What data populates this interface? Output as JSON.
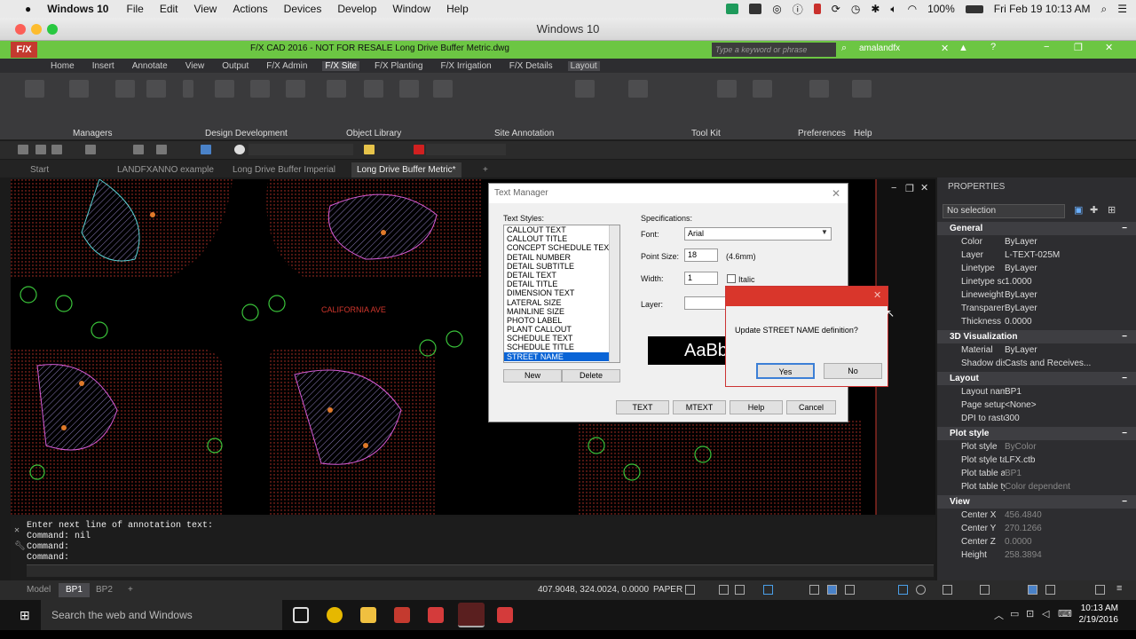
{
  "mac_menubar": {
    "app": "Windows 10",
    "menus": [
      "File",
      "Edit",
      "View",
      "Actions",
      "Devices",
      "Develop",
      "Window",
      "Help"
    ],
    "battery": "100%",
    "datetime": "Fri Feb 19  10:13 AM"
  },
  "window_title": "Windows 10",
  "acad": {
    "logo": "F/X",
    "title": "F/X CAD 2016 - NOT FOR RESALE    Long Drive Buffer Metric.dwg",
    "search_placeholder": "Type a keyword or phrase",
    "user": "amalandfx",
    "ribbon_tabs": [
      "Home",
      "Insert",
      "Annotate",
      "View",
      "Output",
      "F/X Admin",
      "F/X Site",
      "F/X Planting",
      "F/X Irrigation",
      "F/X Details",
      "Layout"
    ],
    "active_tab": "F/X Site",
    "ribbon_groups": [
      "Managers",
      "Design Development",
      "Object Library",
      "Site Annotation",
      "Tool Kit",
      "Preferences",
      "Help"
    ],
    "file_tabs": [
      "Start",
      "LANDFXANNO example",
      "Long Drive Buffer Imperial",
      "Long Drive Buffer Metric*"
    ],
    "active_file": "Long Drive Buffer Metric*"
  },
  "drawing": {
    "street_label": "CALIFORNIA  AVE"
  },
  "text_manager": {
    "title": "Text Manager",
    "styles_label": "Text Styles:",
    "styles": [
      "CALLOUT TEXT",
      "CALLOUT TITLE",
      "CONCEPT SCHEDULE TEXT",
      "DETAIL NUMBER",
      "DETAIL SUBTITLE",
      "DETAIL TEXT",
      "DETAIL TITLE",
      "DIMENSION TEXT",
      "LATERAL SIZE",
      "MAINLINE SIZE",
      "PHOTO LABEL",
      "PLANT CALLOUT",
      "SCHEDULE TEXT",
      "SCHEDULE TITLE",
      "STREET NAME"
    ],
    "selected_style": "STREET NAME",
    "new_btn": "New",
    "delete_btn": "Delete",
    "specs_label": "Specifications:",
    "font_label": "Font:",
    "font_value": "Arial",
    "point_size_label": "Point Size:",
    "point_size_value": "18",
    "point_size_mm": "(4.6mm)",
    "width_label": "Width:",
    "width_value": "1",
    "italic_label": "Italic",
    "layer_label": "Layer:",
    "preview": "AaBb",
    "text_btn": "TEXT",
    "mtext_btn": "MTEXT",
    "help_btn": "Help",
    "cancel_btn": "Cancel"
  },
  "prompt": {
    "message": "Update STREET NAME definition?",
    "yes": "Yes",
    "no": "No"
  },
  "properties": {
    "header": "PROPERTIES",
    "selection": "No selection",
    "sections": [
      {
        "name": "General",
        "rows": [
          {
            "k": "Color",
            "v": "ByLayer"
          },
          {
            "k": "Layer",
            "v": "L-TEXT-025M"
          },
          {
            "k": "Linetype",
            "v": "ByLayer"
          },
          {
            "k": "Linetype scale",
            "v": "1.0000"
          },
          {
            "k": "Lineweight",
            "v": "ByLayer"
          },
          {
            "k": "Transparency",
            "v": "ByLayer"
          },
          {
            "k": "Thickness",
            "v": "0.0000"
          }
        ]
      },
      {
        "name": "3D Visualization",
        "rows": [
          {
            "k": "Material",
            "v": "ByLayer"
          },
          {
            "k": "Shadow display",
            "v": "Casts and Receives..."
          }
        ]
      },
      {
        "name": "Layout",
        "rows": [
          {
            "k": "Layout name",
            "v": "BP1"
          },
          {
            "k": "Page setup na...",
            "v": "<None>"
          },
          {
            "k": "DPI to raster",
            "v": "300"
          }
        ]
      },
      {
        "name": "Plot style",
        "rows": [
          {
            "k": "Plot style",
            "v": "ByColor"
          },
          {
            "k": "Plot style table",
            "v": "LFX.ctb"
          },
          {
            "k": "Plot table attac...",
            "v": "BP1"
          },
          {
            "k": "Plot table type",
            "v": "Color dependent"
          }
        ]
      },
      {
        "name": "View",
        "rows": [
          {
            "k": "Center X",
            "v": "456.4840"
          },
          {
            "k": "Center Y",
            "v": "270.1266"
          },
          {
            "k": "Center Z",
            "v": "0.0000"
          },
          {
            "k": "Height",
            "v": "258.3894"
          }
        ]
      }
    ]
  },
  "command": {
    "lines": [
      "Enter next line of annotation text:",
      "Command: nil",
      "Command:",
      "Command:"
    ]
  },
  "status": {
    "layout_tabs": [
      "Model",
      "BP1",
      "BP2"
    ],
    "active_layout": "BP1",
    "coords": "407.9048, 324.0024, 0.0000",
    "space": "PAPER"
  },
  "taskbar": {
    "search": "Search the web and Windows",
    "time": "10:13 AM",
    "date": "2/19/2016"
  }
}
